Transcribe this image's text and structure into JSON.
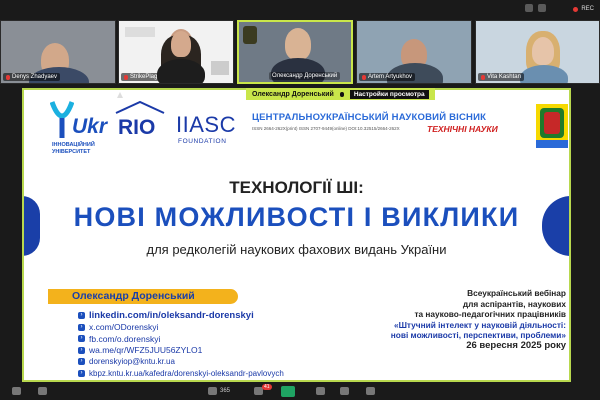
{
  "topbar": {
    "rec_label": "REC"
  },
  "participants": [
    {
      "name": "Denys Zhadyaev",
      "muted": true
    },
    {
      "name": "StrikePlagiarism.com",
      "muted": true
    },
    {
      "name": "Олександр Доренський",
      "muted": false,
      "active": true
    },
    {
      "name": "Artem Artyukhov",
      "muted": true
    },
    {
      "name": "Vita Kashtan",
      "muted": true
    }
  ],
  "share_bar": {
    "presenter": "Олександр Доренський",
    "view_options": "Настройки просмотра"
  },
  "slide": {
    "logo_ukr": "Ukr",
    "logo_ukr_sub_line1": "ІННОВАЦІЙНИЙ",
    "logo_ukr_sub_line2": "УНІВЕРСИТЕТ",
    "logo_rio": "RIO",
    "logo_iiasc": "IIASC",
    "logo_iiasc_sub": "FOUNDATION",
    "journal_title": "ЦЕНТРАЛЬНОУКРАЇНСЬКИЙ НАУКОВИЙ ВІСНИК",
    "journal_issn": "ISSN 2664-262X(print) ISSN 2707-9449(online) DOI:10.32515/2664-262X",
    "journal_sub": "ТЕХНІЧНІ НАУКИ",
    "title_line1": "ТЕХНОЛОГІЇ ШІ:",
    "title_line2": "НОВІ МОЖЛИВОСТІ І ВИКЛИКИ",
    "title_line3": "для редколегій наукових фахових видань України",
    "speaker": "Олександр Доренський",
    "links": [
      "linkedin.com/in/oleksandr-dorenskyi",
      "x.com/ODorenskyi",
      "fb.com/o.dorenskyi",
      "wa.me/qr/WFZ5JUU56ZYLO1",
      "dorenskyiop@kntu.kr.ua",
      "kbpz.kntu.kr.ua/kafedra/dorenskyi-oleksandr-pavlovych"
    ],
    "event_line1": "Всеукраїнський вебінар",
    "event_line2": "для аспірантів, наукових",
    "event_line3": "та науково-педагогічних працівників",
    "event_line4": "«Штучний інтелект у науковій діяльності:",
    "event_line5": "нові можливості, перспективи, проблеми»",
    "event_date": "26 вересня 2025 року"
  },
  "bottombar": {
    "participants_count": "365",
    "chat_badge": "41"
  },
  "colors": {
    "accent": "#c9e64a",
    "brand_blue": "#1b4fbd",
    "speaker_bar": "#f3b21c"
  }
}
